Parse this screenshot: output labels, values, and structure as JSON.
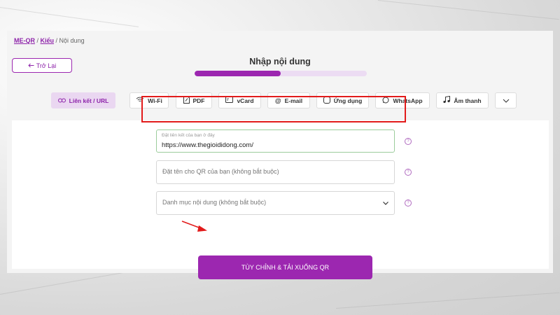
{
  "breadcrumb": {
    "root": "ME-QR",
    "sep1": " / ",
    "style": "Kiểu",
    "sep2": " / ",
    "current": "Nội dung"
  },
  "header": {
    "back_label": "Trở Lại",
    "title": "Nhập nội dung",
    "progress_fraction": 0.5
  },
  "tabs": [
    {
      "label": "Liên kết / URL",
      "icon": "link-icon",
      "active": true
    },
    {
      "label": "Wi-Fi",
      "icon": "wifi-icon"
    },
    {
      "label": "PDF",
      "icon": "pdf-icon"
    },
    {
      "label": "vCard",
      "icon": "vcard-icon"
    },
    {
      "label": "E-mail",
      "icon": "at-icon"
    },
    {
      "label": "Ứng dụng",
      "icon": "app-icon"
    },
    {
      "label": "WhatsApp",
      "icon": "whatsapp-icon"
    },
    {
      "label": "Âm thanh",
      "icon": "music-icon"
    },
    {
      "label": "",
      "icon": "chevron-down-icon"
    }
  ],
  "form": {
    "url_label": "Đặt liên kết của bạn ở đây",
    "url_value": "https://www.thegioididong.com/",
    "name_placeholder": "Đặt tên cho QR của bạn (không bắt buộc)",
    "category_placeholder": "Danh mục nội dung (không bắt buộc)",
    "help_glyph": "?",
    "submit_label": "TÙY CHỈNH & TẢI XUỐNG QR"
  },
  "colors": {
    "accent": "#9c27b0",
    "highlight": "#e21b1b"
  }
}
